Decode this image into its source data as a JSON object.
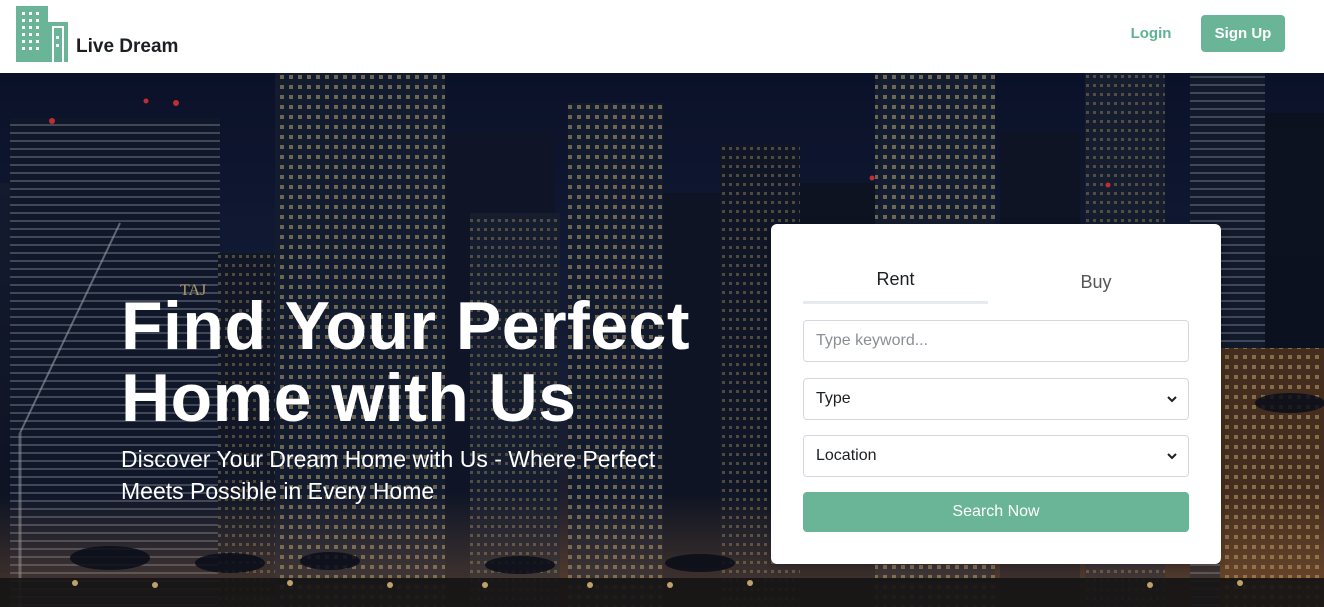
{
  "header": {
    "brand": "Live Dream",
    "login_label": "Login",
    "signup_label": "Sign Up"
  },
  "hero": {
    "headline_line1": "Find Your Perfect",
    "headline_line2": "Home with Us",
    "subline": "Discover Your Dream Home with Us - Where Perfect Meets Possible in Every Home",
    "sign_text": "TAJ"
  },
  "search": {
    "tabs": [
      {
        "label": "Rent",
        "active": true
      },
      {
        "label": "Buy",
        "active": false
      }
    ],
    "keyword_placeholder": "Type keyword...",
    "type_selected": "Type",
    "location_selected": "Location",
    "submit_label": "Search Now"
  },
  "colors": {
    "accent": "#6ab597",
    "accent_text": "#5db392",
    "night_sky": "#0d1530"
  },
  "icons": {
    "logo": "buildings-logo-icon",
    "select_arrow": "chevron-down-icon"
  }
}
